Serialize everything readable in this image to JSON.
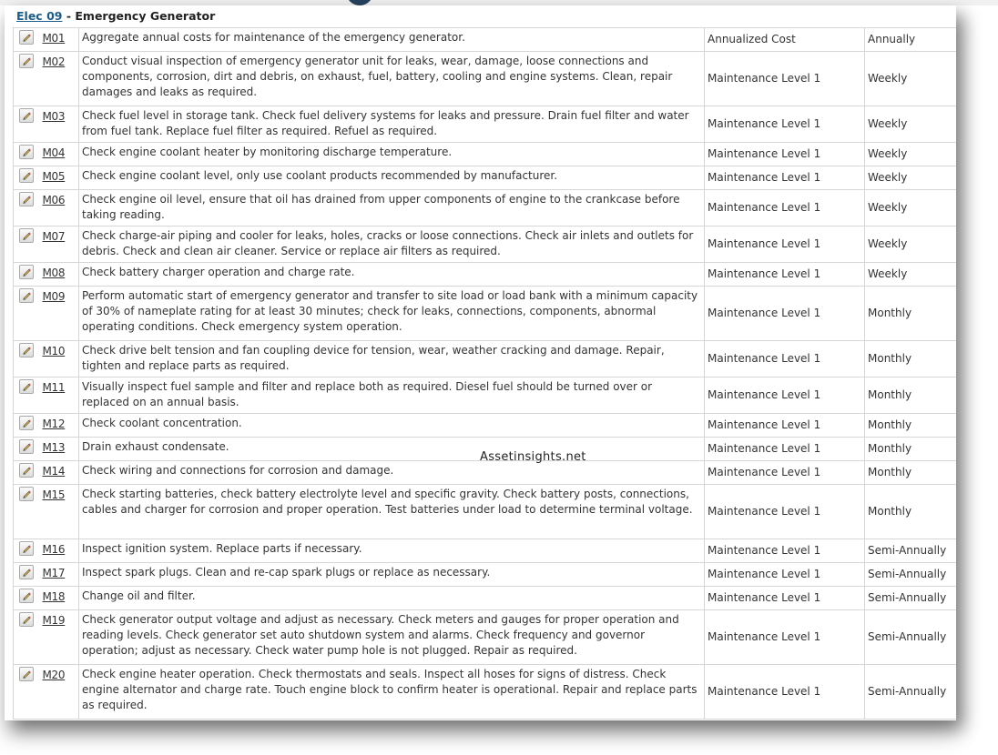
{
  "header": {
    "asset_code": "Elec 09",
    "separator": " - ",
    "asset_name": "Emergency Generator"
  },
  "watermark": "Assetinsights.net",
  "icons": {
    "edit": "pencil-edit-icon"
  },
  "rows": [
    {
      "code": "M01",
      "description": "Aggregate annual costs for maintenance of the emergency generator.",
      "category": "Annualized Cost",
      "frequency": "Annually"
    },
    {
      "code": "M02",
      "description": "Conduct visual inspection of emergency generator unit for leaks, wear, damage, loose connections and components, corrosion, dirt and debris, on exhaust, fuel, battery, cooling and engine systems. Clean, repair damages and leaks as required.",
      "category": "Maintenance Level 1",
      "frequency": "Weekly"
    },
    {
      "code": "M03",
      "description": "Check fuel level in storage tank. Check fuel delivery systems for leaks and pressure. Drain fuel filter and water from fuel tank. Replace fuel filter as required. Refuel as required.",
      "category": "Maintenance Level 1",
      "frequency": "Weekly"
    },
    {
      "code": "M04",
      "description": "Check engine coolant heater by monitoring discharge temperature.",
      "category": "Maintenance Level 1",
      "frequency": "Weekly"
    },
    {
      "code": "M05",
      "description": "Check engine coolant level, only use coolant products recommended by manufacturer.",
      "category": "Maintenance Level 1",
      "frequency": "Weekly"
    },
    {
      "code": "M06",
      "description": "Check engine oil level, ensure that oil has drained from upper components of engine to the crankcase before taking reading.",
      "category": "Maintenance Level 1",
      "frequency": "Weekly"
    },
    {
      "code": "M07",
      "description": "Check charge-air piping and cooler for leaks, holes, cracks or loose connections. Check air inlets and outlets for debris. Check and clean air cleaner. Service or replace air filters as required.",
      "category": "Maintenance Level 1",
      "frequency": "Weekly"
    },
    {
      "code": "M08",
      "description": "Check battery charger operation and charge rate.",
      "category": "Maintenance Level 1",
      "frequency": "Weekly"
    },
    {
      "code": "M09",
      "description": "Perform automatic start of emergency generator and transfer to site load or load bank with a minimum capacity of 30% of nameplate rating for at least 30 minutes; check for leaks, connections, components, abnormal operating conditions. Check emergency system operation.",
      "category": "Maintenance Level 1",
      "frequency": "Monthly"
    },
    {
      "code": "M10",
      "description": "Check drive belt tension and fan coupling device for tension, wear, weather cracking and damage. Repair, tighten and replace parts as required.",
      "category": "Maintenance Level 1",
      "frequency": "Monthly"
    },
    {
      "code": "M11",
      "description": "Visually inspect fuel sample and filter and replace both as required. Diesel fuel should be turned over or replaced on an annual basis.",
      "category": "Maintenance Level 1",
      "frequency": "Monthly"
    },
    {
      "code": "M12",
      "description": "Check coolant concentration.",
      "category": "Maintenance Level 1",
      "frequency": "Monthly"
    },
    {
      "code": "M13",
      "description": "Drain exhaust condensate.",
      "category": "Maintenance Level 1",
      "frequency": "Monthly"
    },
    {
      "code": "M14",
      "description": "Check wiring and connections for corrosion and damage.",
      "category": "Maintenance Level 1",
      "frequency": "Monthly"
    },
    {
      "code": "M15",
      "description": "Check starting batteries, check battery electrolyte level and specific gravity. Check battery posts, connections, cables and charger for corrosion and proper operation. Test batteries under load to determine terminal voltage.",
      "category": "Maintenance Level 1",
      "frequency": "Monthly"
    },
    {
      "code": "M16",
      "description": "Inspect ignition system. Replace parts if necessary.",
      "category": "Maintenance Level 1",
      "frequency": "Semi-Annually"
    },
    {
      "code": "M17",
      "description": "Inspect spark plugs. Clean and re-cap spark plugs or replace as necessary.",
      "category": "Maintenance Level 1",
      "frequency": "Semi-Annually"
    },
    {
      "code": "M18",
      "description": "Change oil and filter.",
      "category": "Maintenance Level 1",
      "frequency": "Semi-Annually"
    },
    {
      "code": "M19",
      "description": "Check generator output voltage and adjust as necessary. Check meters and gauges for proper operation and reading levels. Check generator set auto shutdown system and alarms. Check frequency and governor operation; adjust as necessary. Check water pump hole is not plugged. Repair as required.",
      "category": "Maintenance Level 1",
      "frequency": "Semi-Annually"
    },
    {
      "code": "M20",
      "description": "Check engine heater operation. Check thermostats and seals. Inspect all hoses for signs of distress. Check engine alternator and charge rate. Touch engine block to confirm heater is operational. Repair and replace parts as required.",
      "category": "Maintenance Level 1",
      "frequency": "Semi-Annually"
    }
  ]
}
